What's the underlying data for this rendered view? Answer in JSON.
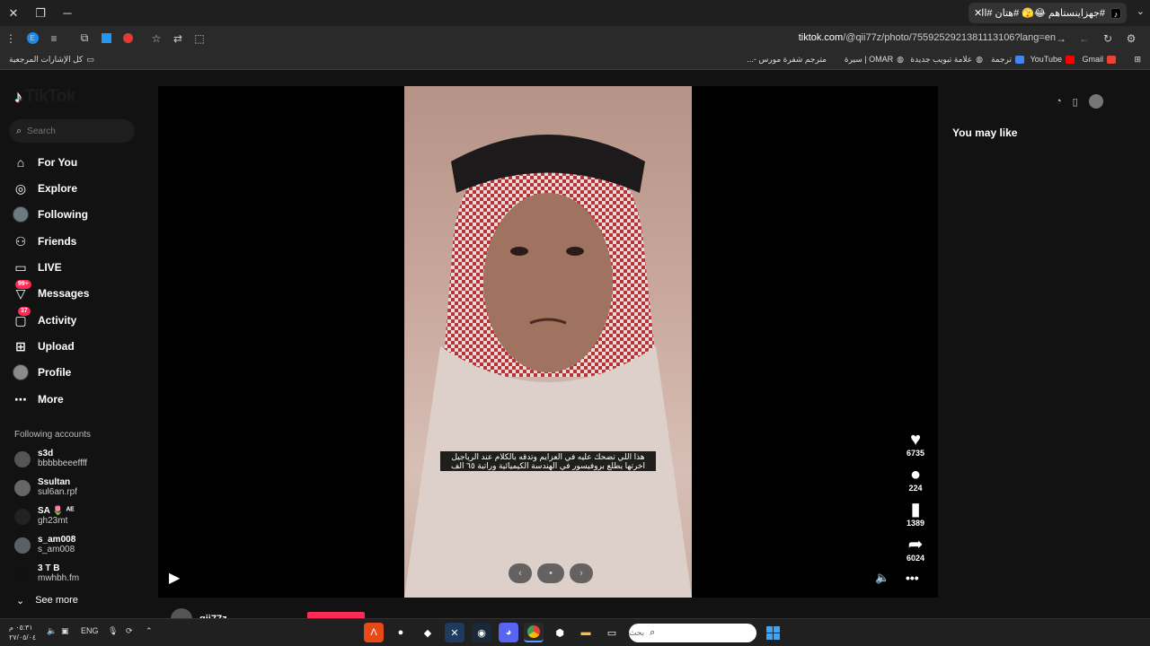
{
  "browser": {
    "tab_title": "#جهزاينستاهم 😂🫣 #هتان #القـ",
    "url_host": "tiktok.com",
    "url_path": "/@qii77z/photo/7559252921381113106?lang=en",
    "bookmarks_folder": "كل الإشارات المرجعية",
    "bookmarks": [
      "Gmail",
      "YouTube",
      "ترجمة",
      "علامة تبويب جديدة",
      "OMAR | سيرة",
      "مترجم شفرة مورس -..."
    ]
  },
  "tiktok": {
    "logo": "TikTok",
    "search_placeholder": "Search",
    "nav": [
      {
        "label": "For You",
        "icon": "home-icon"
      },
      {
        "label": "Explore",
        "icon": "compass-icon"
      },
      {
        "label": "Following",
        "icon": "following-avatar"
      },
      {
        "label": "Friends",
        "icon": "friends-icon"
      },
      {
        "label": "LIVE",
        "icon": "live-icon"
      },
      {
        "label": "Messages",
        "icon": "messages-icon",
        "badge": "99+"
      },
      {
        "label": "Activity",
        "icon": "activity-icon",
        "badge": "37"
      },
      {
        "label": "Upload",
        "icon": "upload-icon"
      },
      {
        "label": "Profile",
        "icon": "profile-avatar"
      },
      {
        "label": "More",
        "icon": "more-icon"
      }
    ],
    "following_title": "Following accounts",
    "following": [
      {
        "name": "s3d",
        "handle": "bbbbbeeeffff"
      },
      {
        "name": "Ssultan",
        "handle": "sul6an.rpf"
      },
      {
        "name": "SA 🌷 ᴬᴱ",
        "handle": "gh23mt"
      },
      {
        "name": "s_am008",
        "handle": "s_am008"
      },
      {
        "name": "3 T B",
        "handle": "mwhbh.fm"
      }
    ],
    "see_more": "See more",
    "caption_line1": "هذا اللي تضحك عليه في العزايم وتدقه بالكلام عند الرياجيل",
    "caption_line2": "اخرتها يطلع بروفيسور في الهندسة الكيميائية وراتبة ٦٥ الف",
    "likes": "6735",
    "comments": "224",
    "saves": "1389",
    "shares": "6024",
    "you_may_like": "You may like",
    "username": "qii77z"
  },
  "taskbar": {
    "search_placeholder": "بحث",
    "lang": "ENG",
    "time": "٠٥:٣١ م",
    "date": "٢٧/٠٥/٠٤"
  }
}
